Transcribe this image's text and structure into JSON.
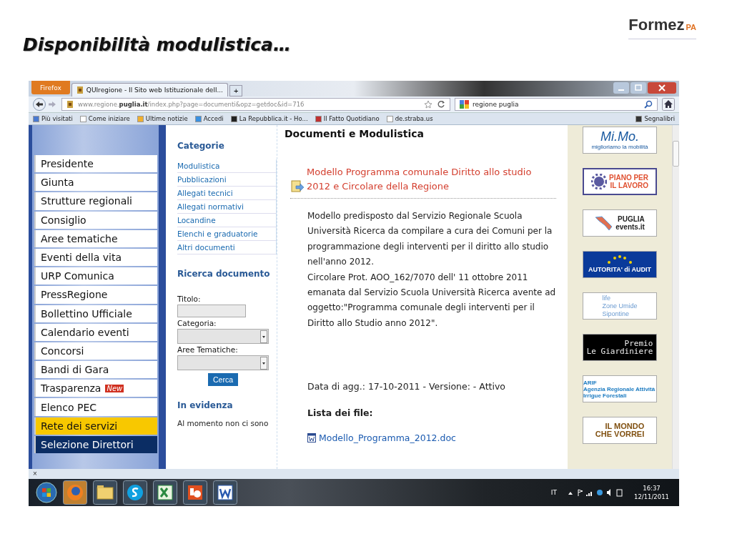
{
  "slide": {
    "title": "Disponibilità modulistica…",
    "logo": {
      "text": "Formez",
      "suffix": "PA"
    }
  },
  "browser": {
    "app_button": "Firefox",
    "tabs": [
      {
        "label": "QUIregione - Il Sito web Istituzionale dell...",
        "selected": true
      }
    ],
    "new_tab": "+",
    "url": {
      "pre": "www.regione.",
      "bold": "puglia.it",
      "post": "/index.php?page=documenti&opz=getdoc&id=716"
    },
    "search": {
      "value": "regione puglia"
    },
    "bookmarks": [
      "Più visitati",
      "Come iniziare",
      "Ultime notizie",
      "Accedi",
      "La Repubblica.it - Ho...",
      "Il Fatto Quotidiano",
      "de.straba.us"
    ],
    "bookmarks_menu": "Segnalibri"
  },
  "sidebar": {
    "items": [
      {
        "label": "Presidente",
        "kind": "plain"
      },
      {
        "label": "Giunta",
        "kind": "plain"
      },
      {
        "label": "Strutture regionali",
        "kind": "plain"
      },
      {
        "label": "Consiglio",
        "kind": "plain"
      },
      {
        "label": "Aree tematiche",
        "kind": "plain"
      },
      {
        "label": "Eventi della vita",
        "kind": "plain"
      },
      {
        "label": "URP Comunica",
        "kind": "plain"
      },
      {
        "label": "PressRegione",
        "kind": "plain"
      },
      {
        "label": "Bollettino Ufficiale",
        "kind": "plain"
      },
      {
        "label": "Calendario eventi",
        "kind": "plain"
      },
      {
        "label": "Concorsi",
        "kind": "plain"
      },
      {
        "label": "Bandi di Gara",
        "kind": "plain"
      },
      {
        "label": "Trasparenza",
        "kind": "plain",
        "badge": "New"
      },
      {
        "label": "Elenco PEC",
        "kind": "plain"
      },
      {
        "label": "Rete dei servizi",
        "kind": "highlighted"
      },
      {
        "label": "Selezione Direttori",
        "kind": "dark"
      }
    ]
  },
  "categories": {
    "heading": "Categorie",
    "items": [
      "Modulistica",
      "Pubblicazioni",
      "Allegati tecnici",
      "Allegati normativi",
      "Locandine",
      "Elenchi e graduatorie",
      "Altri documenti"
    ]
  },
  "search_form": {
    "heading": "Ricerca documento",
    "fields": [
      {
        "label": "Titolo:",
        "kind": "text"
      },
      {
        "label": "Categoria:",
        "kind": "select"
      },
      {
        "label": "Aree Tematiche:",
        "kind": "select"
      }
    ],
    "button": "Cerca"
  },
  "highlights": {
    "heading": "In evidenza",
    "text": "Al momento non ci sono"
  },
  "document": {
    "heading": "Documenti e Modulistica",
    "title": "Modello Programma comunale Diritto allo studio 2012 e Circolare della Regione",
    "description": [
      "Modello predisposto dal Servizio Regionale Scuola Università Ricerca da compilare a cura dei Comuni per la programmazione degli interventi per il diritto allo studio nell'anno 2012.",
      "Circolare Prot. AOO_162/7070 dell' 11 ottobre 2011 emanata dal Servizio Scuola Università Ricerca avente ad oggetto:\"Programma comunale degli interventi per il Diritto allo Studio anno 2012\"."
    ],
    "meta": "Data di agg.: 17-10-2011 - Versione: - Attivo",
    "files_heading": "Lista dei file:",
    "files": [
      "Modello_Programma_2012.doc"
    ]
  },
  "banners": [
    {
      "lines": [
        "Mi.Mo.",
        "miglioriamo la mobilità"
      ],
      "kind": "mimo"
    },
    {
      "lines": [
        "PIANO PER",
        "IL LAVORO"
      ],
      "kind": "lavoro"
    },
    {
      "lines": [
        "PUGLIA",
        "events.it"
      ],
      "kind": "events"
    },
    {
      "lines": [
        "AUTORITA' di AUDIT"
      ],
      "kind": "audit"
    },
    {
      "lines": [
        "life",
        "Zone Umide",
        "Sipontine"
      ],
      "kind": "life"
    },
    {
      "lines": [
        "Premio",
        "Le Giardiniere"
      ],
      "kind": "premio"
    },
    {
      "lines": [
        "ARIF",
        "Agenzia Regionale Attività Irrigue Forestali"
      ],
      "kind": "arif"
    },
    {
      "lines": [
        "IL MONDO",
        "CHE VORREI"
      ],
      "kind": "mondo"
    }
  ],
  "status_bar": {
    "close": "×"
  },
  "taskbar": {
    "apps": [
      {
        "kind": "browser",
        "selected": true
      },
      {
        "kind": "folder",
        "selected": false
      },
      {
        "kind": "chat",
        "selected": false
      },
      {
        "kind": "spreadsheet",
        "selected": false
      },
      {
        "kind": "slides",
        "selected": false
      },
      {
        "kind": "writer",
        "selected": false
      }
    ],
    "language": "IT",
    "time": "16:37",
    "date": "12/11/2011"
  }
}
